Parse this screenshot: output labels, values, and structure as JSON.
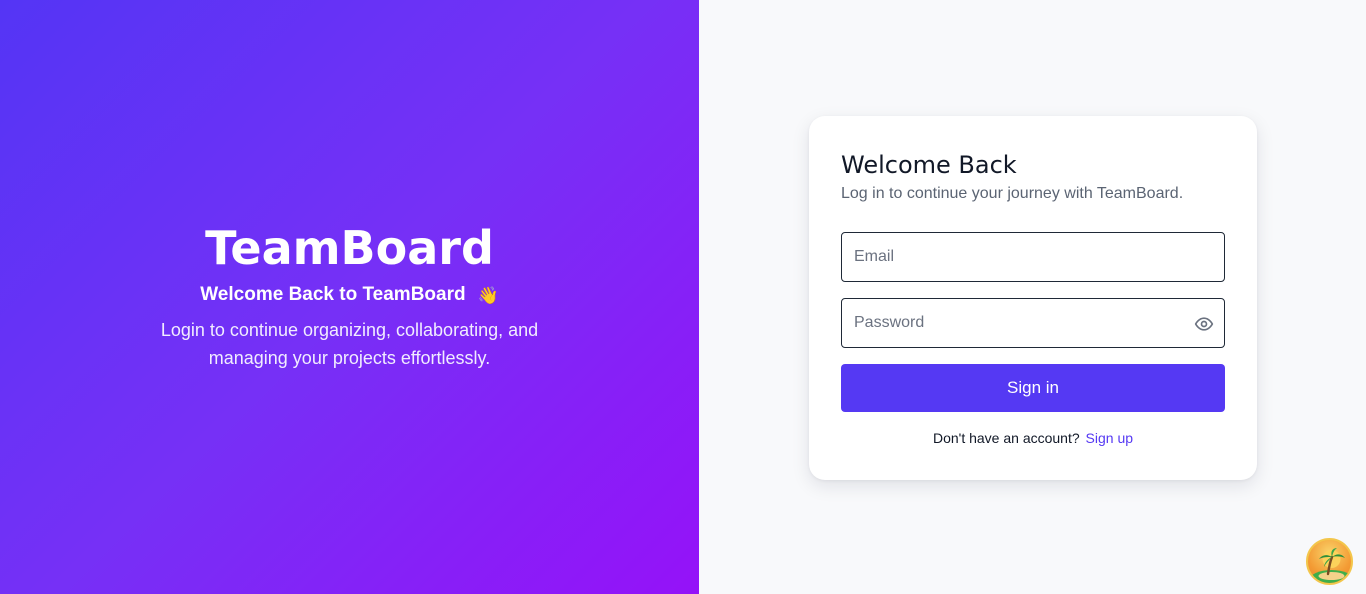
{
  "hero": {
    "title": "TeamBoard",
    "subtitle": "Welcome Back to TeamBoard",
    "subtitle_emoji": "👋",
    "description": "Login to continue organizing, collaborating, and managing your projects effortlessly."
  },
  "login": {
    "title": "Welcome Back",
    "subtitle": "Log in to continue your journey with TeamBoard.",
    "email": {
      "placeholder": "Email",
      "value": ""
    },
    "password": {
      "placeholder": "Password",
      "value": ""
    },
    "submit_label": "Sign in",
    "signup_prompt": "Don't have an account?",
    "signup_link": "Sign up"
  },
  "icons": {
    "password_toggle": "eye-icon",
    "floating_widget": "avatar-beach-icon"
  },
  "colors": {
    "gradient_start": "#5435f5",
    "gradient_end": "#9512f8",
    "accent": "#5539f3",
    "panel_bg": "#f8f9fb"
  }
}
